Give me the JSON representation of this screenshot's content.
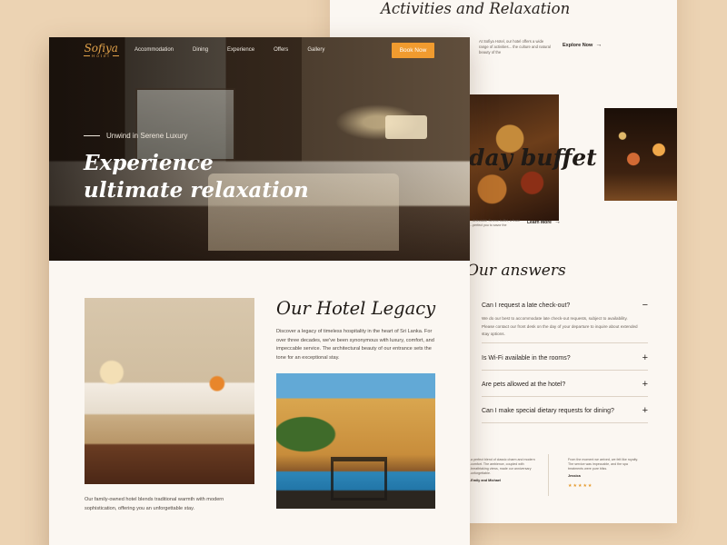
{
  "back_page": {
    "header_title": "Elevate Your Stay with Memorable Activities and Relaxation",
    "header_desc": "At Sofiya Hotel, our hotel offers a wide range of activities... the culture and natural beauty of the",
    "explore_label": "Explore Now",
    "buffet_title": "day buffet",
    "buffet_desc": "...delectable Serene buffet, a feast ...perfect you to savor the",
    "learn_label": "Learn More",
    "faq_title": "Our answers",
    "faq": [
      {
        "question": "Can I request a late check-out?",
        "answer": "We do our best to accommodate late check-out requests, subject to availability. Please contact our front desk on the day of your departure to inquire about extended stay options.",
        "sign": "−"
      },
      {
        "question": "Is Wi-Fi available in the rooms?",
        "answer": "",
        "sign": "+"
      },
      {
        "question": "Are pets allowed at the hotel?",
        "answer": "",
        "sign": "+"
      },
      {
        "question": "Can I make special dietary requests for dining?",
        "answer": "",
        "sign": "+"
      }
    ],
    "testimonials": [
      {
        "text": "...a perfect blend of classic charm and modern ...comfort. The ambience, coupled with ...breathtaking views, made our anniversary ...unforgettable.",
        "name": "...Emily and Michael",
        "stars": "★★★★★"
      },
      {
        "text": "From the moment we arrived, we felt like royalty. The service was impeccable, and the spa treatments were pure bliss.",
        "name": "Jessica",
        "stars": "★★★★★"
      }
    ]
  },
  "front_page": {
    "logo_main": "Sofiya",
    "logo_sub": "Hotel",
    "nav": [
      "Accommodation",
      "Dining",
      "Experience",
      "Offers",
      "Gallery"
    ],
    "book_label": "Book Now",
    "hero_tag": "Unwind in Serene Luxury",
    "hero_title": "Experience ultimate relaxation",
    "legacy_title": "Our Hotel Legacy",
    "legacy_text": "Discover a legacy of timeless hospitality in the heart of Sri Lanka. For over three decades, we've been synonymous with luxury, comfort, and impeccable service. The architectural beauty of our entrance sets the tone for an exceptional stay.",
    "room_caption": "Our family-owned hotel blends traditional warmth with modern sophistication, offering you an unforgettable stay."
  },
  "colors": {
    "background": "#ecd3b3",
    "accent": "#f09b2f",
    "page": "#fbf7f2",
    "text_dark": "#1f1a16",
    "stars": "#e59a2c"
  }
}
